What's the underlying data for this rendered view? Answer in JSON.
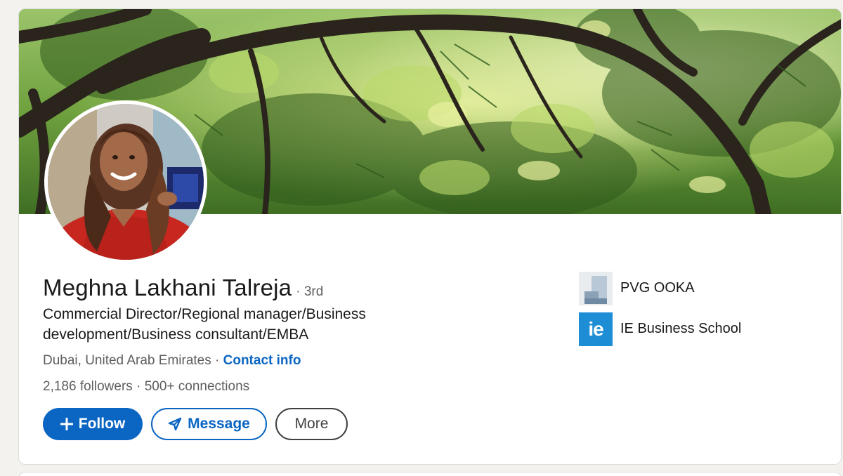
{
  "profile": {
    "name": "Meghna Lakhani Talreja",
    "degree": "· 3rd",
    "headline": "Commercial Director/Regional manager/Business development/Business consultant/EMBA",
    "location": "Dubai, United Arab Emirates",
    "location_separator": " · ",
    "contact_label": "Contact info",
    "followers": "2,186 followers",
    "connections_separator": " · ",
    "connections": "500+ connections"
  },
  "actions": {
    "follow_label": "Follow",
    "follow_icon": "plus-icon",
    "message_label": "Message",
    "message_icon": "send-icon",
    "more_label": "More"
  },
  "organizations": [
    {
      "name": "PVG OOKA",
      "logo": "pvg-ooka-logo"
    },
    {
      "name": "IE Business School",
      "logo": "ie-business-school-logo",
      "logo_text": "ie"
    }
  ],
  "colors": {
    "accent": "#0a66c2",
    "page_background": "#f3f2ef",
    "card_background": "#ffffff",
    "ie_brand": "#1d8ed6"
  }
}
